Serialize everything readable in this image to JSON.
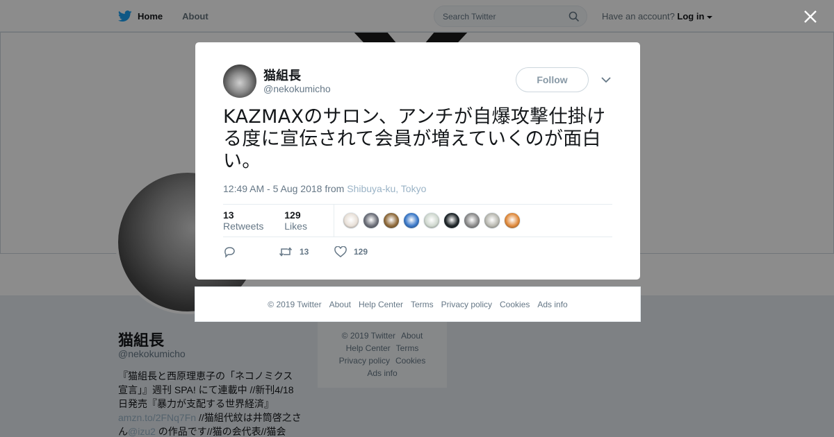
{
  "topbar": {
    "home_label": "Home",
    "about_label": "About",
    "search_placeholder": "Search Twitter",
    "login_prompt": "Have an account?",
    "login_label": "Log in"
  },
  "profile": {
    "name": "猫組長",
    "handle": "@nekokumicho",
    "bio_part1": "『猫組長と西原理恵子の「ネコノミクス宣言」』週刊 SPA! にて連載中 //新刊4/18日発売『暴力が支配する世界経済』",
    "bio_link1": "amzn.to/2FNq7Fn",
    "bio_part2": " //猫組代紋は井筒啓之さん",
    "bio_link2": "@izu2",
    "bio_part3": " の作品です//猫の会代表//猫会"
  },
  "side_footer": {
    "items": [
      "© 2019 Twitter",
      "About",
      "Help Center",
      "Terms",
      "Privacy policy",
      "Cookies",
      "Ads info"
    ]
  },
  "tweet": {
    "author_name": "猫組長",
    "author_handle": "@nekokumicho",
    "follow_label": "Follow",
    "text": "KAZMAXのサロン、アンチが自爆攻撃仕掛ける度に宣伝されて会員が増えていくのが面白い。",
    "timestamp": "12:49 AM - 5 Aug 2018 from ",
    "place": "Shibuya-ku, Tokyo",
    "retweets_count": "13",
    "retweets_label": "Retweets",
    "likes_count": "129",
    "likes_label": "Likes",
    "reply_count": "",
    "retweet_action_count": "13",
    "like_action_count": "129",
    "liker_colors": [
      "#e8e0d8",
      "#6b6e78",
      "#8f6a3a",
      "#3a78c8",
      "#cfd8cf",
      "#1e2528",
      "#8a8a8a",
      "#b8b8b0",
      "#e08a3c"
    ]
  },
  "modal_footer": {
    "items": [
      "© 2019 Twitter",
      "About",
      "Help Center",
      "Terms",
      "Privacy policy",
      "Cookies",
      "Ads info"
    ]
  },
  "colors": {
    "brand": "#1da1f2",
    "text_secondary": "#657786",
    "link_muted": "#9ab3c6"
  },
  "icons": [
    "twitter-bird-icon",
    "home-icon",
    "search-icon",
    "caret-down-icon",
    "close-icon",
    "reply-icon",
    "retweet-icon",
    "heart-icon"
  ]
}
